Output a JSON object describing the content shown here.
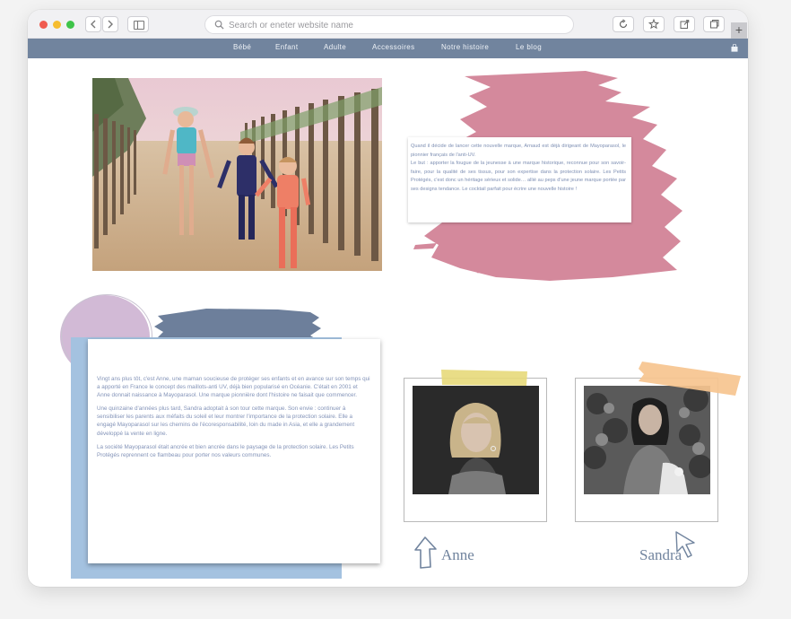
{
  "browser": {
    "url_placeholder": "Search or eneter website name"
  },
  "nav": {
    "items": [
      {
        "label": "Bébé"
      },
      {
        "label": "Enfant"
      },
      {
        "label": "Adulte"
      },
      {
        "label": "Accessoires"
      },
      {
        "label": "Notre histoire"
      },
      {
        "label": "Le blog"
      }
    ]
  },
  "intro": {
    "p1": "Quand il décide de lancer cette nouvelle marque, Arnaud est déjà dirigeant de Mayoparasol, le pionnier français de l'anti-UV.",
    "p2": "Le but : apporter la fougue de la jeunesse à une marque historique, reconnue pour son savoir-faire, pour la qualité de ses tissus, pour son expertise dans la protection solaire. Les Petits Protégés, c'est donc un héritage sérieux et solide… allié au peps d'une jeune marque portée par ses designs tendance. Le cocktail parfait pour écrire une nouvelle histoire !"
  },
  "story": {
    "p1": "Vingt ans plus tôt, c'est Anne, une maman soucieuse de protéger ses enfants et en avance sur son temps qui a apporté en France le concept des maillots-anti UV, déjà bien popularisé en Océanie. C'était en 2001 et Anne donnait naissance à Mayoparasol. Une marque pionnière dont l'histoire ne faisait que commencer.",
    "p2": "Une quinzaine d'années plus tard, Sandra adoptait à son tour cette marque. Son envie : continuer à sensibiliser les parents aux méfaits du soleil et leur montrer l'importance de la protection solaire. Elle a engagé Mayoparasol sur les chemins de l'écoresponsabilité, loin du made in Asia, et elle a grandement développé la vente en ligne.",
    "p3": "La société Mayoparasol était ancrée et bien ancrée dans le paysage de la protection solaire. Les Petits Protégés reprennent ce flambeau pour porter nos valeurs communes."
  },
  "founders": [
    {
      "name": "Anne"
    },
    {
      "name": "Sandra"
    }
  ],
  "colors": {
    "nav_bg": "#71849e",
    "pink_brush": "#d4899c",
    "slate_brush": "#6d7f9b",
    "purple_circle": "#d2bad6",
    "blue_block": "#a4c2e0",
    "tape_yellow": "#e7d97a",
    "tape_orange": "#f6c48f",
    "text_blue": "#7e8fb3"
  },
  "icons": [
    "back-chevron-icon",
    "forward-chevron-icon",
    "sidebar-icon",
    "search-icon",
    "reload-icon",
    "star-icon",
    "share-icon",
    "tabs-icon",
    "plus-icon",
    "shopping-bag-icon",
    "arrow-up-icon",
    "cursor-icon"
  ]
}
